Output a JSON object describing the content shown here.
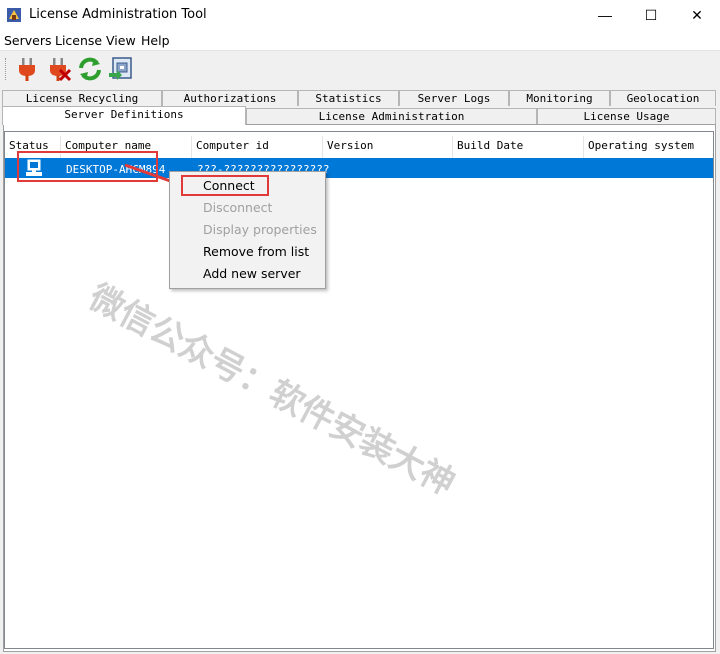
{
  "window": {
    "title": "License Administration Tool",
    "minimize": "—",
    "maximize": "☐",
    "close": "✕"
  },
  "menubar": [
    "Servers",
    "License",
    "View",
    "Help"
  ],
  "toolbar": {
    "buttons": [
      "plug-connect-icon",
      "plug-disconnect-icon",
      "refresh-icon",
      "properties-icon"
    ]
  },
  "tabs": {
    "row1": [
      "License Recycling",
      "Authorizations",
      "Statistics",
      "Server Logs",
      "Monitoring",
      "Geolocation"
    ],
    "row2": [
      "Server Definitions",
      "License Administration",
      "License Usage"
    ],
    "active": "Server Definitions"
  },
  "table": {
    "columns": [
      "Status",
      "Computer name",
      "Computer id",
      "Version",
      "Build Date",
      "Operating system"
    ],
    "rows": [
      {
        "status_icon": "computer-icon",
        "computer_name": "DESKTOP-AHCM894",
        "computer_id": "???-????????????????"
      }
    ]
  },
  "context_menu": {
    "items": [
      {
        "label": "Connect",
        "enabled": true
      },
      {
        "label": "Disconnect",
        "enabled": false
      },
      {
        "label": "Display properties",
        "enabled": false
      },
      {
        "label": "Remove from list",
        "enabled": true
      },
      {
        "label": "Add new server",
        "enabled": true
      }
    ]
  },
  "watermark": "微信公众号：软件安装大神",
  "colors": {
    "selection": "#0078d7",
    "highlight": "#e03a3a"
  }
}
